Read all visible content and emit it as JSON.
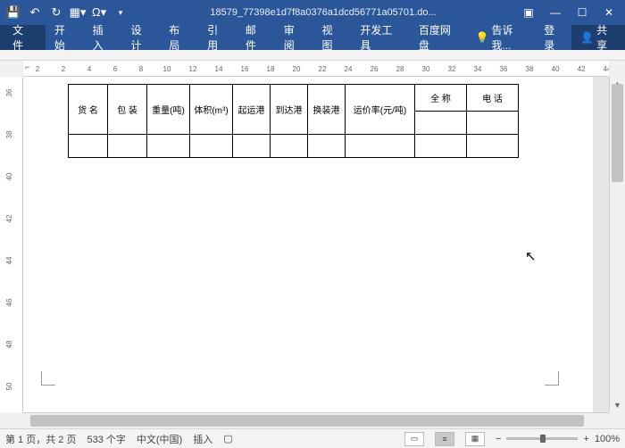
{
  "title": "18579_77398e1d7f8a0376a1dcd56771a05701.do...",
  "qat": [
    "save",
    "undo",
    "redo",
    "table",
    "omega"
  ],
  "tabs": [
    "文件",
    "开始",
    "插入",
    "设计",
    "布局",
    "引用",
    "邮件",
    "审阅",
    "视图",
    "开发工具",
    "百度网盘"
  ],
  "tellme": "告诉我...",
  "login": "登录",
  "share": "共享",
  "hruler": [
    2,
    2,
    4,
    6,
    8,
    10,
    12,
    14,
    16,
    18,
    20,
    22,
    24,
    26,
    28,
    30,
    32,
    34,
    36,
    38,
    40,
    42,
    44
  ],
  "vruler": [
    36,
    38,
    40,
    42,
    44,
    46,
    48,
    50
  ],
  "table": {
    "headers": [
      "货 名",
      "包 装",
      "重量(吨)",
      "体积(m³)",
      "起运港",
      "到达港",
      "换装港",
      "运价率(元/吨)",
      "全 称",
      "电 话"
    ],
    "rows": 2
  },
  "status": {
    "page": "第 1 页，共 2 页",
    "words": "533 个字",
    "lang": "中文(中国)",
    "mode": "插入",
    "zoom": "100%"
  }
}
